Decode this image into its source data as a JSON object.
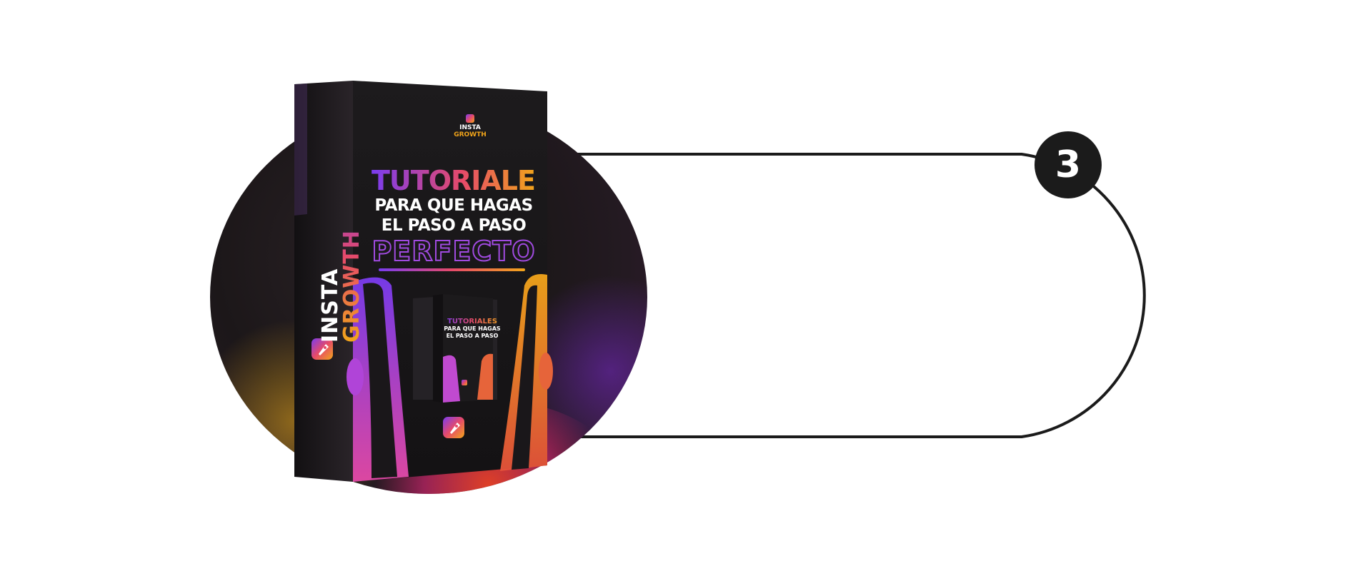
{
  "step_badge": {
    "number": "3"
  },
  "product_box": {
    "spine": {
      "line1": "INSTA",
      "line2": "GROWTH"
    },
    "front_logo": {
      "line1": "INSTA",
      "line2": "GROWTH"
    },
    "title": {
      "main": "TUTORIALES",
      "sub1": "PARA QUE HAGAS",
      "sub2": "EL PASO A PASO",
      "last": "PERFECTO"
    },
    "mini_box_title": {
      "main": "TUTORIALES",
      "sub1": "PARA QUE HAGAS",
      "sub2": "EL PASO A PASO"
    }
  },
  "colors": {
    "brand_purple": "#7a3cf0",
    "brand_pink": "#e64a6a",
    "brand_orange": "#f2a51a",
    "box_dark": "#1a1a1a",
    "outline": "#1b1b1b"
  },
  "icons": {
    "spine_logo": "rocket-icon",
    "front_bottom_logo": "rocket-icon"
  }
}
